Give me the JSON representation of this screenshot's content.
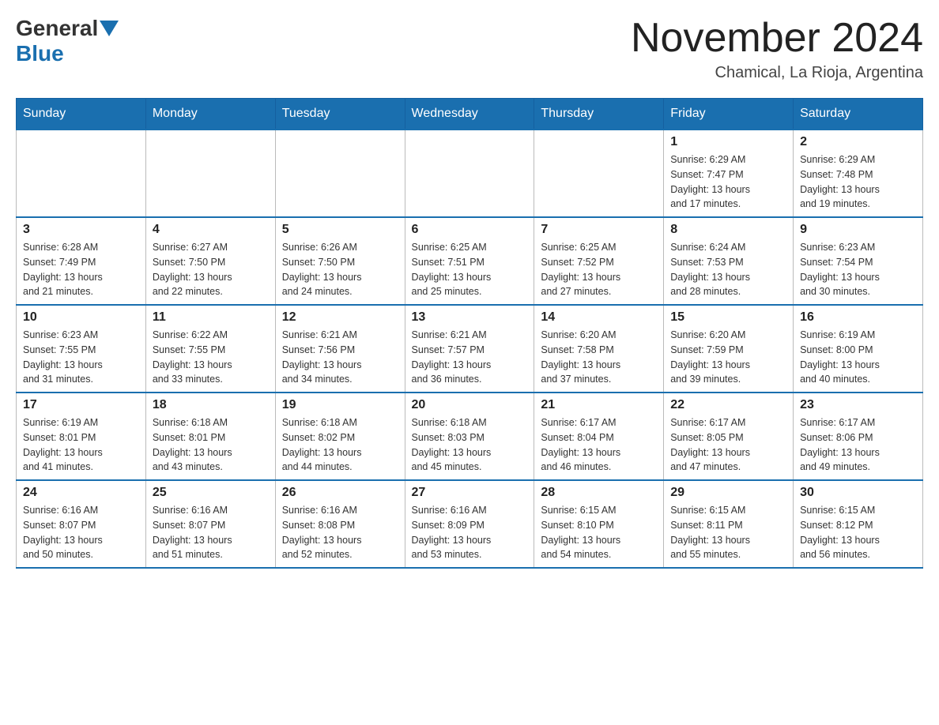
{
  "logo": {
    "general": "General",
    "blue": "Blue"
  },
  "title": "November 2024",
  "location": "Chamical, La Rioja, Argentina",
  "weekdays": [
    "Sunday",
    "Monday",
    "Tuesday",
    "Wednesday",
    "Thursday",
    "Friday",
    "Saturday"
  ],
  "weeks": [
    [
      {
        "day": "",
        "info": ""
      },
      {
        "day": "",
        "info": ""
      },
      {
        "day": "",
        "info": ""
      },
      {
        "day": "",
        "info": ""
      },
      {
        "day": "",
        "info": ""
      },
      {
        "day": "1",
        "info": "Sunrise: 6:29 AM\nSunset: 7:47 PM\nDaylight: 13 hours\nand 17 minutes."
      },
      {
        "day": "2",
        "info": "Sunrise: 6:29 AM\nSunset: 7:48 PM\nDaylight: 13 hours\nand 19 minutes."
      }
    ],
    [
      {
        "day": "3",
        "info": "Sunrise: 6:28 AM\nSunset: 7:49 PM\nDaylight: 13 hours\nand 21 minutes."
      },
      {
        "day": "4",
        "info": "Sunrise: 6:27 AM\nSunset: 7:50 PM\nDaylight: 13 hours\nand 22 minutes."
      },
      {
        "day": "5",
        "info": "Sunrise: 6:26 AM\nSunset: 7:50 PM\nDaylight: 13 hours\nand 24 minutes."
      },
      {
        "day": "6",
        "info": "Sunrise: 6:25 AM\nSunset: 7:51 PM\nDaylight: 13 hours\nand 25 minutes."
      },
      {
        "day": "7",
        "info": "Sunrise: 6:25 AM\nSunset: 7:52 PM\nDaylight: 13 hours\nand 27 minutes."
      },
      {
        "day": "8",
        "info": "Sunrise: 6:24 AM\nSunset: 7:53 PM\nDaylight: 13 hours\nand 28 minutes."
      },
      {
        "day": "9",
        "info": "Sunrise: 6:23 AM\nSunset: 7:54 PM\nDaylight: 13 hours\nand 30 minutes."
      }
    ],
    [
      {
        "day": "10",
        "info": "Sunrise: 6:23 AM\nSunset: 7:55 PM\nDaylight: 13 hours\nand 31 minutes."
      },
      {
        "day": "11",
        "info": "Sunrise: 6:22 AM\nSunset: 7:55 PM\nDaylight: 13 hours\nand 33 minutes."
      },
      {
        "day": "12",
        "info": "Sunrise: 6:21 AM\nSunset: 7:56 PM\nDaylight: 13 hours\nand 34 minutes."
      },
      {
        "day": "13",
        "info": "Sunrise: 6:21 AM\nSunset: 7:57 PM\nDaylight: 13 hours\nand 36 minutes."
      },
      {
        "day": "14",
        "info": "Sunrise: 6:20 AM\nSunset: 7:58 PM\nDaylight: 13 hours\nand 37 minutes."
      },
      {
        "day": "15",
        "info": "Sunrise: 6:20 AM\nSunset: 7:59 PM\nDaylight: 13 hours\nand 39 minutes."
      },
      {
        "day": "16",
        "info": "Sunrise: 6:19 AM\nSunset: 8:00 PM\nDaylight: 13 hours\nand 40 minutes."
      }
    ],
    [
      {
        "day": "17",
        "info": "Sunrise: 6:19 AM\nSunset: 8:01 PM\nDaylight: 13 hours\nand 41 minutes."
      },
      {
        "day": "18",
        "info": "Sunrise: 6:18 AM\nSunset: 8:01 PM\nDaylight: 13 hours\nand 43 minutes."
      },
      {
        "day": "19",
        "info": "Sunrise: 6:18 AM\nSunset: 8:02 PM\nDaylight: 13 hours\nand 44 minutes."
      },
      {
        "day": "20",
        "info": "Sunrise: 6:18 AM\nSunset: 8:03 PM\nDaylight: 13 hours\nand 45 minutes."
      },
      {
        "day": "21",
        "info": "Sunrise: 6:17 AM\nSunset: 8:04 PM\nDaylight: 13 hours\nand 46 minutes."
      },
      {
        "day": "22",
        "info": "Sunrise: 6:17 AM\nSunset: 8:05 PM\nDaylight: 13 hours\nand 47 minutes."
      },
      {
        "day": "23",
        "info": "Sunrise: 6:17 AM\nSunset: 8:06 PM\nDaylight: 13 hours\nand 49 minutes."
      }
    ],
    [
      {
        "day": "24",
        "info": "Sunrise: 6:16 AM\nSunset: 8:07 PM\nDaylight: 13 hours\nand 50 minutes."
      },
      {
        "day": "25",
        "info": "Sunrise: 6:16 AM\nSunset: 8:07 PM\nDaylight: 13 hours\nand 51 minutes."
      },
      {
        "day": "26",
        "info": "Sunrise: 6:16 AM\nSunset: 8:08 PM\nDaylight: 13 hours\nand 52 minutes."
      },
      {
        "day": "27",
        "info": "Sunrise: 6:16 AM\nSunset: 8:09 PM\nDaylight: 13 hours\nand 53 minutes."
      },
      {
        "day": "28",
        "info": "Sunrise: 6:15 AM\nSunset: 8:10 PM\nDaylight: 13 hours\nand 54 minutes."
      },
      {
        "day": "29",
        "info": "Sunrise: 6:15 AM\nSunset: 8:11 PM\nDaylight: 13 hours\nand 55 minutes."
      },
      {
        "day": "30",
        "info": "Sunrise: 6:15 AM\nSunset: 8:12 PM\nDaylight: 13 hours\nand 56 minutes."
      }
    ]
  ]
}
